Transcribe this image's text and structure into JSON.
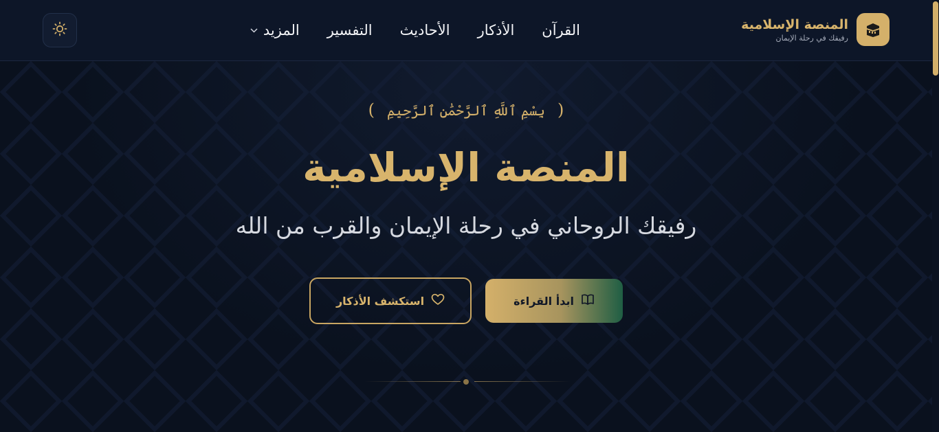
{
  "header": {
    "brand_title": "المنصة الإسلامية",
    "brand_subtitle": "رفيقك في رحلة الإيمان",
    "logo_icon": "kaaba-icon",
    "theme_icon": "sun-icon",
    "nav": [
      {
        "label": "القرآن"
      },
      {
        "label": "الأذكار"
      },
      {
        "label": "الأحاديث"
      },
      {
        "label": "التفسير"
      },
      {
        "label": "المزيد",
        "icon": "chevron-down-icon"
      }
    ]
  },
  "hero": {
    "bismillah": "بِسْمِ ٱللَّهِ ٱلرَّحْمَٰنِ ٱلرَّحِيمِ",
    "paren_open": "(",
    "paren_close": ")",
    "title": "المنصة الإسلامية",
    "subtitle": "رفيقك الروحاني في رحلة الإيمان والقرب من الله",
    "primary_button": {
      "label": "ابدأ القراءة",
      "icon": "book-open-icon"
    },
    "secondary_button": {
      "label": "استكشف الأذكار",
      "icon": "heart-icon"
    }
  },
  "colors": {
    "accent_gold": "#d4b06a",
    "background": "#0a111e",
    "header_bg": "#0d1628",
    "accent_green": "#1f5e44"
  }
}
